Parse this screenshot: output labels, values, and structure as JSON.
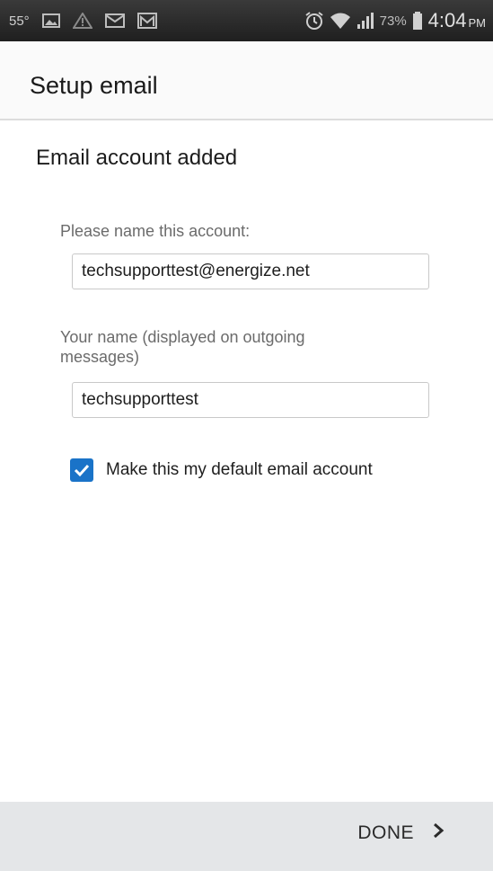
{
  "status_bar": {
    "temperature": "55°",
    "battery_percent": "73%",
    "time": "4:04",
    "am_pm": "PM",
    "icons": [
      "image-icon",
      "warning-icon",
      "email-notification-icon",
      "gmail-icon",
      "alarm-icon",
      "wifi-icon",
      "signal-icon",
      "battery-icon"
    ]
  },
  "app_bar": {
    "title": "Setup email"
  },
  "main": {
    "section_title": "Email account added",
    "account_name_label": "Please name this account:",
    "account_name_value": "techsupporttest@energize.net",
    "your_name_label": "Your name (displayed on outgoing messages)",
    "your_name_value": "techsupporttest",
    "default_account_label": "Make this my default email account",
    "default_account_checked": true
  },
  "bottom_bar": {
    "done_label": "DONE",
    "done_icon": "chevron-right-icon"
  },
  "colors": {
    "checkbox": "#1a73c8",
    "status_bar": "#2a2a2a",
    "bottom_bar": "#e4e6e8"
  }
}
